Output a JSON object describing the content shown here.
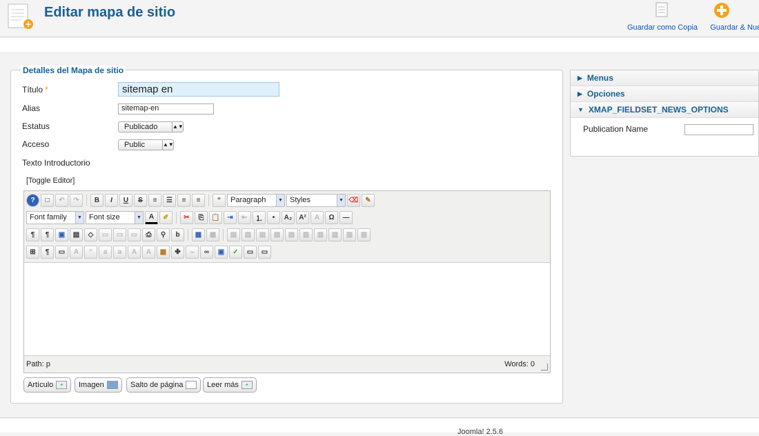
{
  "header": {
    "title": "Editar mapa de sitio",
    "toolbar": {
      "save_copy_label": "Guardar como Copia",
      "save_new_label": "Guardar & Nuevo"
    }
  },
  "form": {
    "legend": "Detalles del Mapa de sitio",
    "title_label": "Título",
    "title_required_mark": "*",
    "title_value": "sitemap en",
    "alias_label": "Alias",
    "alias_value": "sitemap-en",
    "status_label": "Estatus",
    "status_value": "Publicado",
    "access_label": "Acceso",
    "access_value": "Public",
    "intro_label": "Texto Introductorio",
    "toggle_editor": "[Toggle Editor]"
  },
  "editor": {
    "paragraph_select": "Paragraph",
    "styles_select": "Styles",
    "font_family_select": "Font family",
    "font_size_select": "Font size",
    "path_label": "Path: p",
    "words_label": "Words: 0"
  },
  "extra_buttons": {
    "article": "Artículo",
    "image": "Imagen",
    "page_break": "Salto de página",
    "read_more": "Leer más"
  },
  "sidebar": {
    "menus": "Menus",
    "options": "Opciones",
    "news_options": "XMAP_FIELDSET_NEWS_OPTIONS",
    "publication_name_label": "Publication Name",
    "publication_name_value": ""
  },
  "footer": {
    "version": "Joomla! 2.5.6"
  },
  "colors": {
    "accent": "#146295",
    "link": "#0b55c4",
    "title_input_bg": "#def0fb",
    "new_button": "#f7a21b"
  }
}
